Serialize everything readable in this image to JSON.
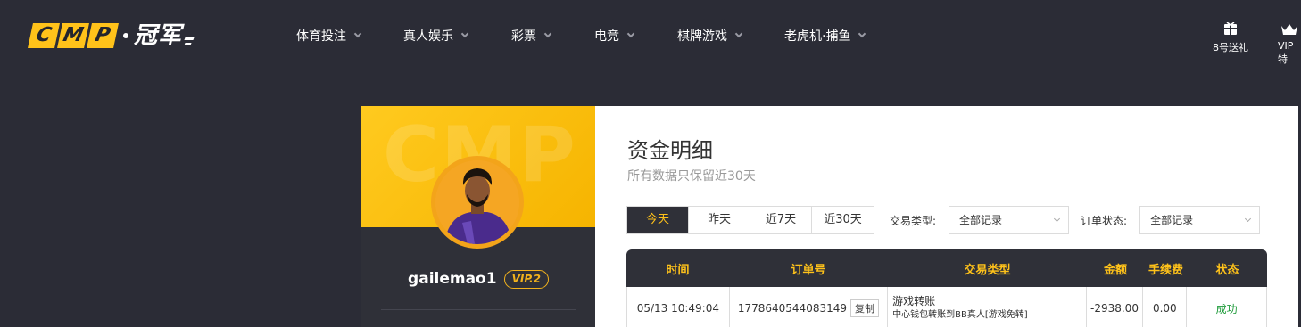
{
  "header": {
    "logo": {
      "cmp_letters": [
        "C",
        "M",
        "P"
      ],
      "cn_text": "冠军"
    },
    "nav": [
      {
        "label": "体育投注"
      },
      {
        "label": "真人娱乐"
      },
      {
        "label": "彩票"
      },
      {
        "label": "电竞"
      },
      {
        "label": "棋牌游戏"
      },
      {
        "label": "老虎机·捕鱼"
      }
    ],
    "right_icons": [
      {
        "label": "8号送礼",
        "icon": "gift-icon"
      },
      {
        "label": "VIP特",
        "icon": "crown-icon"
      }
    ]
  },
  "profile": {
    "banner_watermark": "CMP",
    "username": "gailemao1",
    "vip_level": "VIP.2"
  },
  "panel": {
    "title": "资金明细",
    "subtitle": "所有数据只保留近30天",
    "date_filters": [
      {
        "label": "今天",
        "active": true
      },
      {
        "label": "昨天",
        "active": false
      },
      {
        "label": "近7天",
        "active": false
      },
      {
        "label": "近30天",
        "active": false
      }
    ],
    "type_filter": {
      "label": "交易类型:",
      "value": "全部记录"
    },
    "status_filter": {
      "label": "订单状态:",
      "value": "全部记录"
    },
    "table": {
      "headers": [
        "时间",
        "订单号",
        "交易类型",
        "金额",
        "手续费",
        "状态"
      ],
      "rows": [
        {
          "time": "05/13 10:49:04",
          "order_no": "1778640544083149",
          "copy_label": "复制",
          "type_main": "游戏转账",
          "type_detail": "中心钱包转账到BB真人[游戏免转]",
          "amount": "-2938.00",
          "fee": "0.00",
          "status": "成功"
        }
      ]
    }
  },
  "colors": {
    "page_bg": "#2b2c36",
    "brand_yellow": "#ffc21a",
    "table_header_bg": "#2f3038",
    "success_green": "#1e9b3a"
  }
}
